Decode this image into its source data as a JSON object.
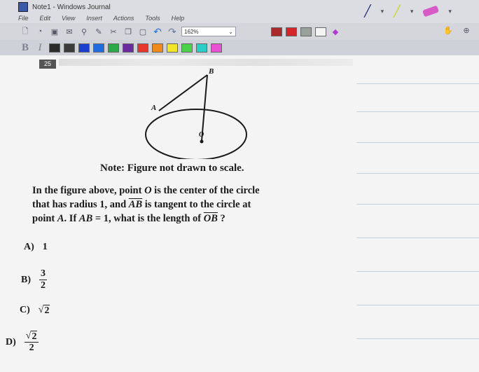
{
  "window": {
    "title": "Note1 - Windows Journal"
  },
  "menu": [
    "File",
    "Edit",
    "View",
    "Insert",
    "Actions",
    "Tools",
    "Help"
  ],
  "toolbar": {
    "zoom": "162%",
    "swatches": [
      "#2c2c2c",
      "#3b3b3b",
      "#1b3fcf",
      "#1f6be0",
      "#2aa84a",
      "#6a2aa0",
      "#e6362d",
      "#f08a1c",
      "#f2e629",
      "#4ad34a",
      "#2ad0c8",
      "#e84fd2",
      "#a82a2a",
      "#d4272b",
      "#9aa09a",
      "#f4f4f4"
    ]
  },
  "format": {
    "bold": "B",
    "italic": "I"
  },
  "page": {
    "number": "25",
    "figure_labels": {
      "b": "B",
      "a": "A",
      "o": "O"
    },
    "note": "Note: Figure not drawn to scale.",
    "question_lines": [
      [
        "In the figure above, point ",
        "O",
        " is the center of the circle"
      ],
      [
        "that has radius 1, and ",
        "AB",
        " is tangent to the circle at"
      ],
      [
        "point ",
        "A",
        ". If ",
        "AB",
        " = 1, what is the length of ",
        "OB",
        " ?"
      ]
    ],
    "choices": [
      {
        "letter": "A)",
        "text": "1"
      },
      {
        "letter": "B)",
        "num": "3",
        "den": "2"
      },
      {
        "letter": "C)",
        "radicand": "2"
      },
      {
        "letter": "D)",
        "radicand": "2",
        "den": "2"
      }
    ]
  }
}
